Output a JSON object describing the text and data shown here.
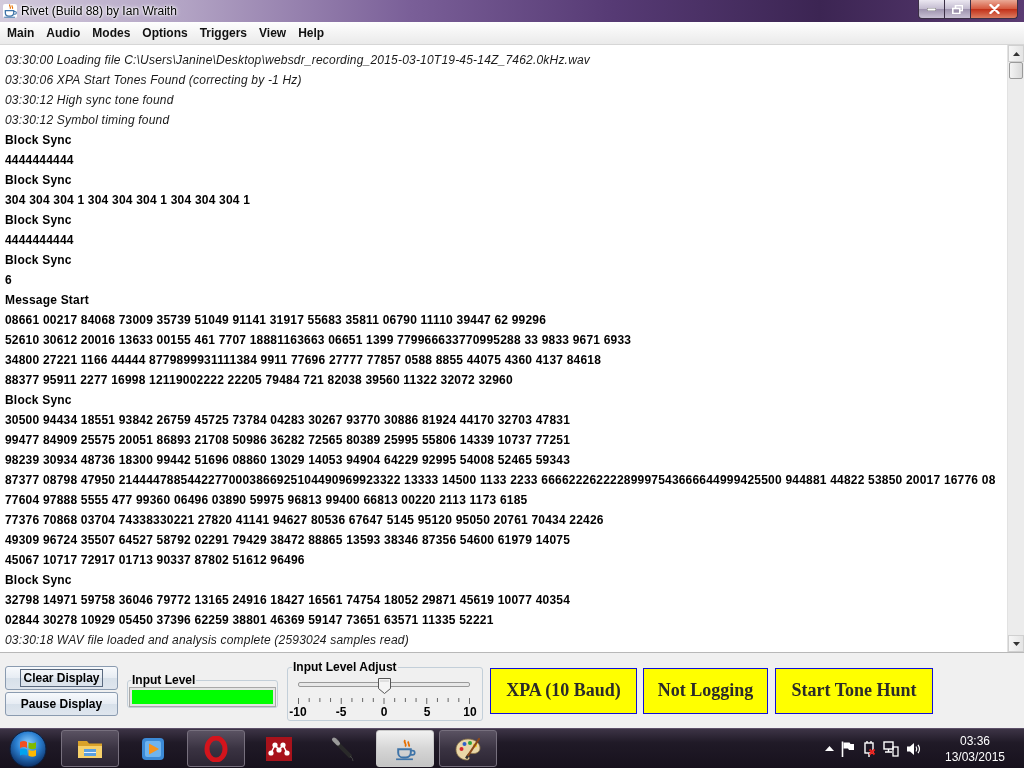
{
  "window": {
    "title": "Rivet (Build 88) by Ian Wraith"
  },
  "menu": [
    "Main",
    "Audio",
    "Modes",
    "Options",
    "Triggers",
    "View",
    "Help"
  ],
  "log": [
    {
      "kind": "event",
      "text": "03:30:00 Loading file C:\\Users\\Janine\\Desktop\\websdr_recording_2015-03-10T19-45-14Z_7462.0kHz.wav"
    },
    {
      "kind": "event",
      "text": "03:30:06 XPA Start Tones Found (correcting by -1 Hz)"
    },
    {
      "kind": "event",
      "text": "03:30:12 High sync tone found"
    },
    {
      "kind": "event",
      "text": "03:30:12 Symbol timing found"
    },
    {
      "kind": "data",
      "text": "Block Sync"
    },
    {
      "kind": "data",
      "text": "4444444444"
    },
    {
      "kind": "data",
      "text": "Block Sync"
    },
    {
      "kind": "data",
      "text": "304 304 304 1 304 304 304 1 304 304 304 1"
    },
    {
      "kind": "data",
      "text": "Block Sync"
    },
    {
      "kind": "data",
      "text": "4444444444"
    },
    {
      "kind": "data",
      "text": "Block Sync"
    },
    {
      "kind": "data",
      "text": "6"
    },
    {
      "kind": "data",
      "text": "Message Start"
    },
    {
      "kind": "data",
      "text": "08661 00217 84068 73009 35739 51049 91141 31917 55683 35811 06790 11110 39447 62 99296"
    },
    {
      "kind": "data",
      "text": "52610 30612 20016 13633 00155 461 7707 18881163663 06651 1399 779966633770995288 33 9833 9671 6933"
    },
    {
      "kind": "data",
      "text": "34800 27221 1166 44444 8779899931111384 9911 77696 27777 77857 0588 8855 44075 4360 4137 84618"
    },
    {
      "kind": "data",
      "text": "88377 95911 2277 16998 12119002222 22205 79484 721 82038 39560 11322 32072 32960"
    },
    {
      "kind": "data",
      "text": "Block Sync"
    },
    {
      "kind": "data",
      "text": "30500 94434 18551 93842 26759 45725 73784 04283 30267 93770 30886 81924 44170 32703 47831"
    },
    {
      "kind": "data",
      "text": "99477 84909 25575 20051 86893 21708 50986 36282 72565 80389 25995 55806 14339 10737 77251"
    },
    {
      "kind": "data",
      "text": "98239 30934 48736 18300 99442 51696 08860 13029 14053 94904 64229 92995 54008 52465 59343"
    },
    {
      "kind": "data",
      "text": "87377 08798 47950 21444478854422770003866925104490969923322 13333 14500 1133 2233 66662226222289997543666644999425500 944881 44822 53850 20017 16776 08"
    },
    {
      "kind": "data",
      "text": "77604 97888 5555 477 99360 06496 03890 59975 96813 99400 66813 00220 2113 1173 6185"
    },
    {
      "kind": "data",
      "text": "77376 70868 03704 74338330221 27820 41141 94627 80536 67647 5145 95120 95050 20761 70434 22426"
    },
    {
      "kind": "data",
      "text": "49309 96724 35507 64527 58792 02291 79429 38472 88865 13593 38346 87356 54600 61979 14075"
    },
    {
      "kind": "data",
      "text": "45067 10717 72917 01713 90337 87802 51612 96496"
    },
    {
      "kind": "data",
      "text": "Block Sync"
    },
    {
      "kind": "data",
      "text": "32798 14971 59758 36046 79772 13165 24916 18427 16561 74754 18052 29871 45619 10077 40354"
    },
    {
      "kind": "data",
      "text": "02844 30278 10929 05450 37396 62259 38801 46369 59147 73651 63571 11335 52221"
    },
    {
      "kind": "event",
      "text": "03:30:18 WAV file loaded and analysis complete (2593024 samples read)"
    }
  ],
  "controls": {
    "buttons": [
      {
        "label": "Clear Display",
        "focused": true
      },
      {
        "label": "Pause Display",
        "focused": false
      }
    ],
    "input_level": {
      "title": "Input Level",
      "level": 1
    },
    "input_level_adjust": {
      "title": "Input Level Adjust",
      "level": 0.5,
      "tick_labels": [
        "-10",
        "-5",
        "0",
        "5",
        "10"
      ]
    },
    "status_buttons": [
      "XPA (10 Baud)",
      "Not Logging",
      "Start Tone Hunt"
    ]
  },
  "taskbar": {
    "apps": [
      {
        "kind": "folder",
        "running": true,
        "selected": false
      },
      {
        "kind": "player",
        "running": false,
        "selected": false
      },
      {
        "kind": "ring",
        "running": true,
        "selected": false
      },
      {
        "kind": "dots",
        "running": false,
        "selected": false
      },
      {
        "kind": "microphone",
        "running": false,
        "selected": false
      },
      {
        "kind": "cup",
        "running": true,
        "selected": true
      },
      {
        "kind": "palette",
        "running": true,
        "selected": false
      }
    ],
    "clock": {
      "time": "03:36",
      "date": "13/03/2015"
    }
  }
}
